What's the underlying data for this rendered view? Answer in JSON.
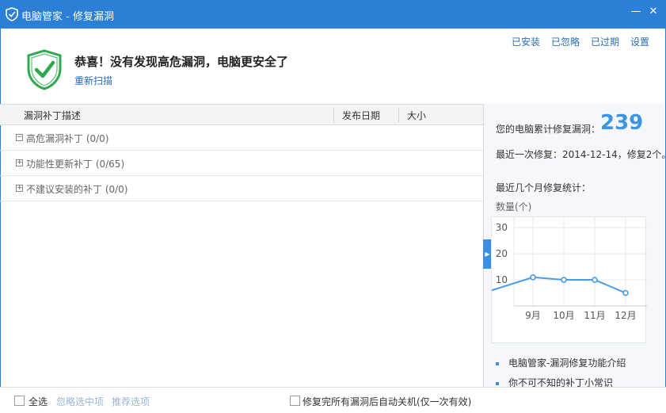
{
  "window": {
    "title": "电脑管家 - 修复漏洞"
  },
  "toplinks": [
    "已安装",
    "已忽略",
    "已过期",
    "设置"
  ],
  "status": {
    "headline": "恭喜！没有发现高危漏洞，电脑更安全了",
    "rescan": "重新扫描"
  },
  "list": {
    "columns": [
      "漏洞补丁描述",
      "发布日期",
      "大小"
    ],
    "groups": [
      {
        "expanded": true,
        "label": "高危漏洞补丁 (0/0)"
      },
      {
        "expanded": false,
        "label": "功能性更新补丁 (0/65)"
      },
      {
        "expanded": false,
        "label": "不建议安装的补丁 (0/0)"
      }
    ]
  },
  "side": {
    "total_label": "您的电脑累计修复漏洞：",
    "total": "239",
    "last_repair": "最近一次修复：2014-12-14，修复2个。",
    "stats_title": "最近几个月修复统计：",
    "unit": "数量(个)",
    "links": [
      "电脑管家-漏洞修复功能介绍",
      "你不可不知的补丁小常识"
    ]
  },
  "chart_data": {
    "type": "line",
    "categories": [
      "9月",
      "10月",
      "11月",
      "12月"
    ],
    "series": [
      {
        "values": [
          11,
          10,
          10,
          5
        ]
      }
    ],
    "start_value": 6,
    "yticks": [
      "10",
      "20",
      "30"
    ],
    "ylim": [
      0,
      34
    ],
    "grid": true,
    "color": "#4a9be8"
  },
  "footer": {
    "select_all": "全选",
    "ignore_selected": "忽略选中项",
    "recommended": "推荐选项",
    "auto_shutdown": "修复完所有漏洞后自动关机(仅一次有效)"
  },
  "colors": {
    "accent": "#2b7fd7",
    "link": "#2b6cb8",
    "total": "#3a95e6",
    "muted": "#9ab5d3"
  }
}
